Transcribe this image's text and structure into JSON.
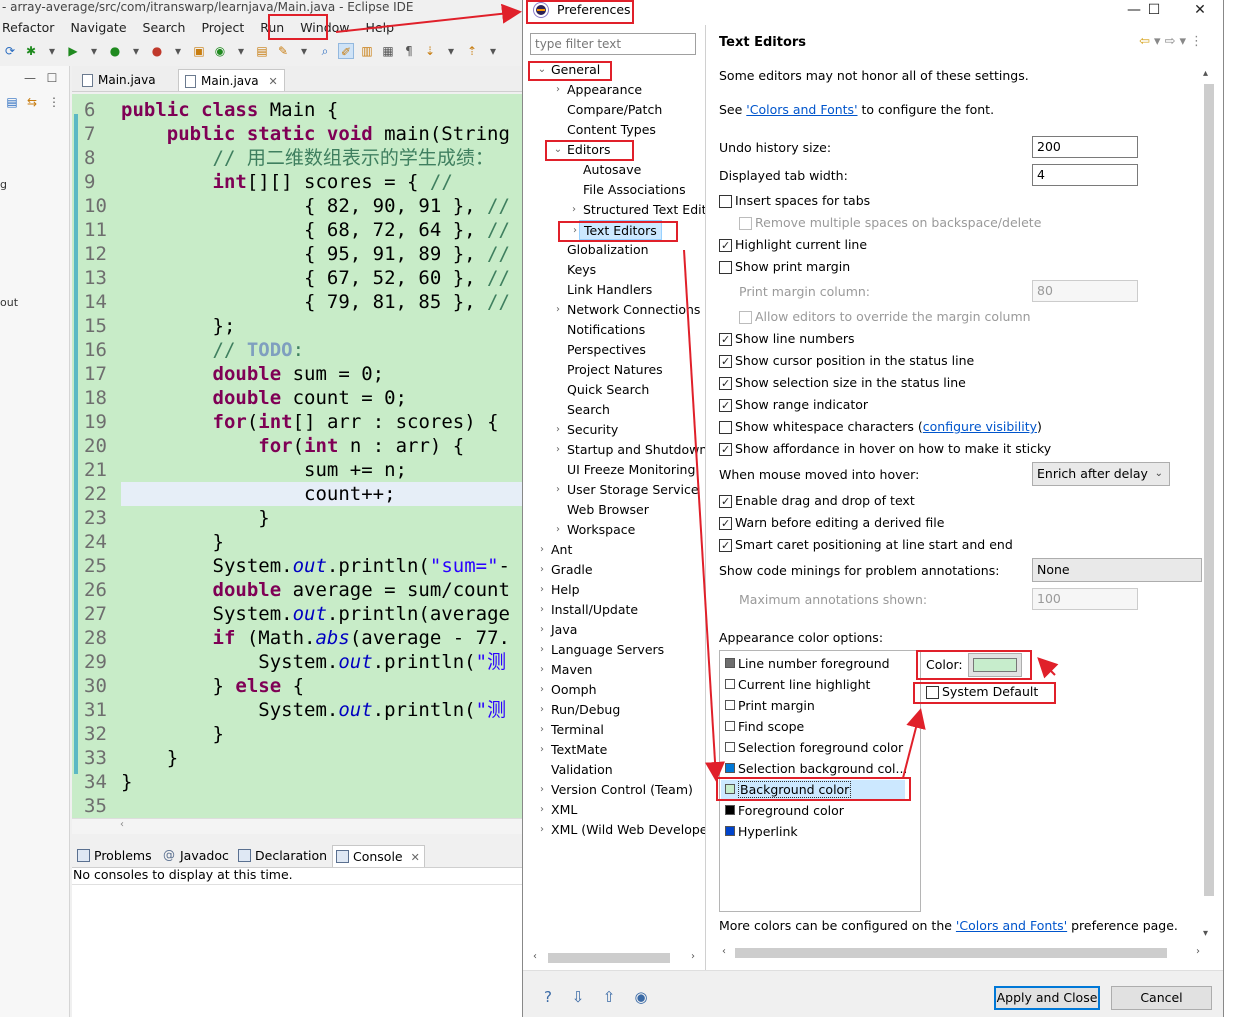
{
  "eclipse": {
    "title": "- array-average/src/com/itranswarp/learnjava/Main.java - Eclipse IDE",
    "menu": [
      "Refactor",
      "Navigate",
      "Search",
      "Project",
      "Run",
      "Window",
      "Help"
    ],
    "left_panel_labels": [
      "g",
      "out"
    ],
    "editor_tabs": [
      {
        "label": "Main.java",
        "active": false
      },
      {
        "label": "Main.java",
        "active": true,
        "close": "✕"
      }
    ],
    "line_numbers": [
      "6",
      "7",
      "8",
      "9",
      "10",
      "11",
      "12",
      "13",
      "14",
      "15",
      "16",
      "17",
      "18",
      "19",
      "20",
      "21",
      "22",
      "23",
      "24",
      "25",
      "26",
      "27",
      "28",
      "29",
      "30",
      "31",
      "32",
      "33",
      "34",
      "35"
    ],
    "hscroll_arrow": "‹",
    "bottom_tabs": [
      "Problems",
      "Javadoc",
      "Declaration",
      "Console"
    ],
    "bottom_tab_close": "✕",
    "console_message": "No consoles to display at this time."
  },
  "dialog": {
    "title": "Preferences",
    "window_buttons": {
      "minimize": "—",
      "maximize": "☐",
      "close": "✕"
    },
    "filter_placeholder": "type filter text",
    "tree": {
      "general": "General",
      "appearance": "Appearance",
      "compare_patch": "Compare/Patch",
      "content_types": "Content Types",
      "editors": "Editors",
      "autosave": "Autosave",
      "file_associations": "File Associations",
      "structured_text": "Structured Text Edit",
      "text_editors": "Text Editors",
      "globalization": "Globalization",
      "keys": "Keys",
      "link_handlers": "Link Handlers",
      "network": "Network Connections",
      "notifications": "Notifications",
      "perspectives": "Perspectives",
      "project_natures": "Project Natures",
      "quick_search": "Quick Search",
      "search": "Search",
      "security": "Security",
      "startup": "Startup and Shutdown",
      "ui_freeze": "UI Freeze Monitoring",
      "user_storage": "User Storage Service",
      "web_browser": "Web Browser",
      "workspace": "Workspace",
      "ant": "Ant",
      "gradle": "Gradle",
      "help": "Help",
      "install_update": "Install/Update",
      "java": "Java",
      "language_servers": "Language Servers",
      "maven": "Maven",
      "oomph": "Oomph",
      "run_debug": "Run/Debug",
      "terminal": "Terminal",
      "textmate": "TextMate",
      "validation": "Validation",
      "version_control": "Version Control (Team)",
      "xml": "XML",
      "xml_wild": "XML (Wild Web Developer)"
    },
    "page": {
      "heading": "Text Editors",
      "intro": "Some editors may not honor all of these settings.",
      "see_prefix": "See ",
      "see_link": "'Colors and Fonts'",
      "see_suffix": " to configure the font.",
      "undo_label": "Undo history size:",
      "undo_value": "200",
      "tab_width_label": "Displayed tab width:",
      "tab_width_value": "4",
      "insert_spaces": "Insert spaces for tabs",
      "remove_multiple": "Remove multiple spaces on backspace/delete",
      "highlight_line": "Highlight current line",
      "print_margin": "Show print margin",
      "print_margin_column_label": "Print margin column:",
      "print_margin_column_value": "80",
      "allow_override": "Allow editors to override the margin column",
      "line_numbers": "Show line numbers",
      "cursor_position": "Show cursor position in the status line",
      "selection_size": "Show selection size in the status line",
      "range_indicator": "Show range indicator",
      "whitespace_prefix": "Show whitespace characters (",
      "whitespace_link": "configure visibility",
      "whitespace_suffix": ")",
      "affordance": "Show affordance in hover on how to make it sticky",
      "hover_label": "When mouse moved into hover:",
      "hover_value": "Enrich after delay",
      "drag_drop": "Enable drag and drop of text",
      "warn_derived": "Warn before editing a derived file",
      "smart_caret": "Smart caret positioning at line start and end",
      "code_minings_label": "Show code minings for problem annotations:",
      "code_minings_value": "None",
      "max_annotations_label": "Maximum annotations shown:",
      "max_annotations_value": "100",
      "appearance_label": "Appearance color options:",
      "color_items": [
        {
          "label": "Line number foreground",
          "color": "#6e6e6e"
        },
        {
          "label": "Current line highlight",
          "color": "#ffffff"
        },
        {
          "label": "Print margin",
          "color": "#ffffff"
        },
        {
          "label": "Find scope",
          "color": "#ffffff"
        },
        {
          "label": "Selection foreground color",
          "color": "#ffffff"
        },
        {
          "label": "Selection background col...",
          "color": "#0078d7"
        },
        {
          "label": "Background color",
          "color": "#c7edcc"
        },
        {
          "label": "Foreground color",
          "color": "#000000"
        },
        {
          "label": "Hyperlink",
          "color": "#0044cc"
        }
      ],
      "color_label": "Color:",
      "color_value": "#c7edcc",
      "system_default": "System Default",
      "more_prefix": "More colors can be configured on the ",
      "more_link": "'Colors and Fonts'",
      "more_suffix": " preference page."
    },
    "apply_close": "Apply and Close",
    "cancel": "Cancel"
  }
}
